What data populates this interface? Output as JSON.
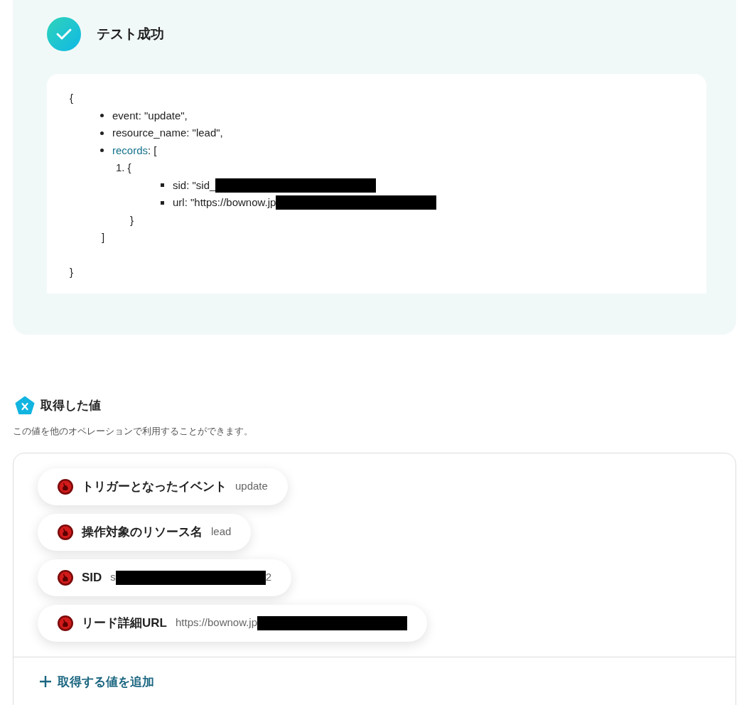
{
  "test_result": {
    "title": "テスト成功",
    "output": {
      "open": "{",
      "close": "}",
      "items": [
        {
          "text": "event: \"update\","
        },
        {
          "text": "resource_name: \"lead\","
        },
        {
          "link": "records",
          "text": ": [",
          "close": "]",
          "children": [
            {
              "number": "1.",
              "open": "{",
              "close": "}",
              "items": [
                {
                  "text": "sid: \"sid_",
                  "redacted": true
                },
                {
                  "text": "url: \"https://bownow.jp",
                  "redacted": true
                }
              ]
            }
          ]
        }
      ]
    }
  },
  "values": {
    "title": "取得した値",
    "description": "この値を他のオペレーションで利用することができます。",
    "items": [
      {
        "label": "トリガーとなったイベント",
        "value": "update",
        "redacted": false
      },
      {
        "label": "操作対象のリソース名",
        "value": "lead",
        "redacted": false
      },
      {
        "label": "SID",
        "value": "s",
        "redacted": true,
        "value_tail": "2"
      },
      {
        "label": "リード詳細URL",
        "value": "https://bownow.jp",
        "redacted": true
      }
    ],
    "add_button": "取得する値を追加"
  }
}
